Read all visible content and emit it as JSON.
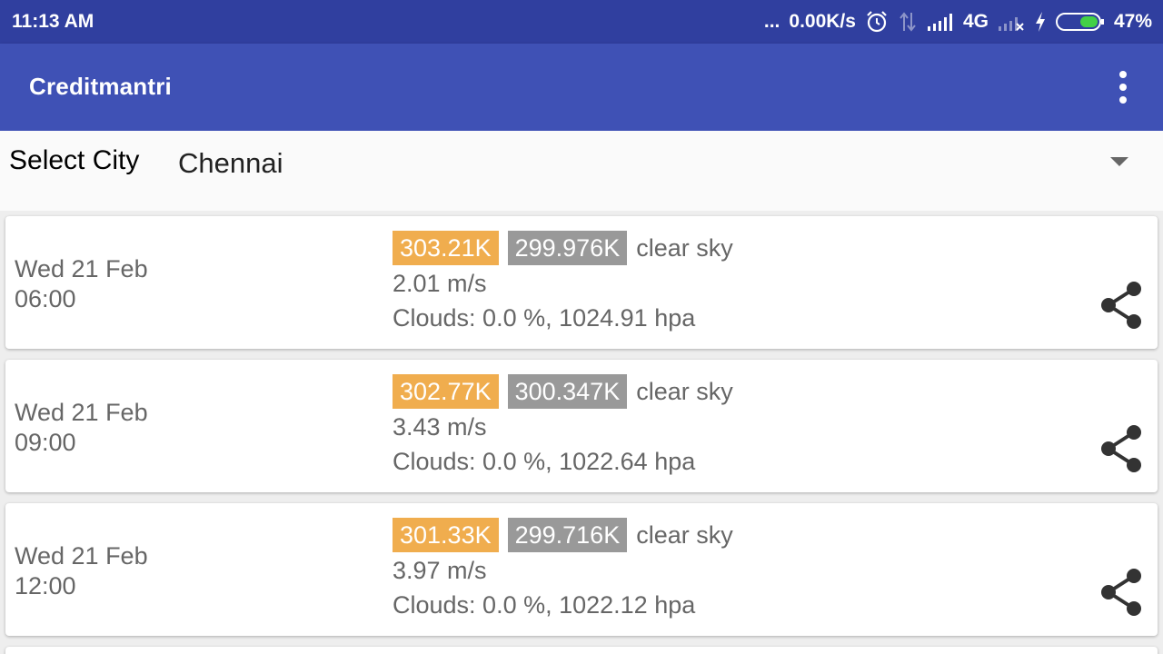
{
  "status_bar": {
    "time": "11:13 AM",
    "dots": "...",
    "speed": "0.00K/s",
    "network": "4G",
    "battery": "47%"
  },
  "app": {
    "title": "Creditmantri"
  },
  "city": {
    "label": "Select City",
    "selected": "Chennai"
  },
  "forecasts": [
    {
      "date": "Wed 21 Feb",
      "time": "06:00",
      "temp_max": "303.21K",
      "temp_min": "299.976K",
      "description": "clear sky",
      "wind": "2.01 m/s",
      "clouds": "Clouds: 0.0 %,  1024.91 hpa"
    },
    {
      "date": "Wed 21 Feb",
      "time": "09:00",
      "temp_max": "302.77K",
      "temp_min": "300.347K",
      "description": "clear sky",
      "wind": "3.43 m/s",
      "clouds": "Clouds: 0.0 %,  1022.64 hpa"
    },
    {
      "date": "Wed 21 Feb",
      "time": "12:00",
      "temp_max": "301.33K",
      "temp_min": "299.716K",
      "description": "clear sky",
      "wind": "3.97 m/s",
      "clouds": "Clouds: 0.0 %,  1022.12 hpa"
    }
  ],
  "colors": {
    "status_bar": "#303f9f",
    "app_bar": "#3f51b5",
    "temp_max_bg": "#f0ad4e",
    "temp_min_bg": "#999999"
  },
  "icons": {
    "alarm": "alarm-icon",
    "data_arrows": "data-arrows-icon",
    "signal": "signal-icon",
    "signal_off": "signal-off-icon",
    "charging": "charging-icon",
    "battery": "battery-icon",
    "overflow": "more-vert-icon",
    "dropdown": "dropdown-arrow-icon",
    "share": "share-icon"
  }
}
